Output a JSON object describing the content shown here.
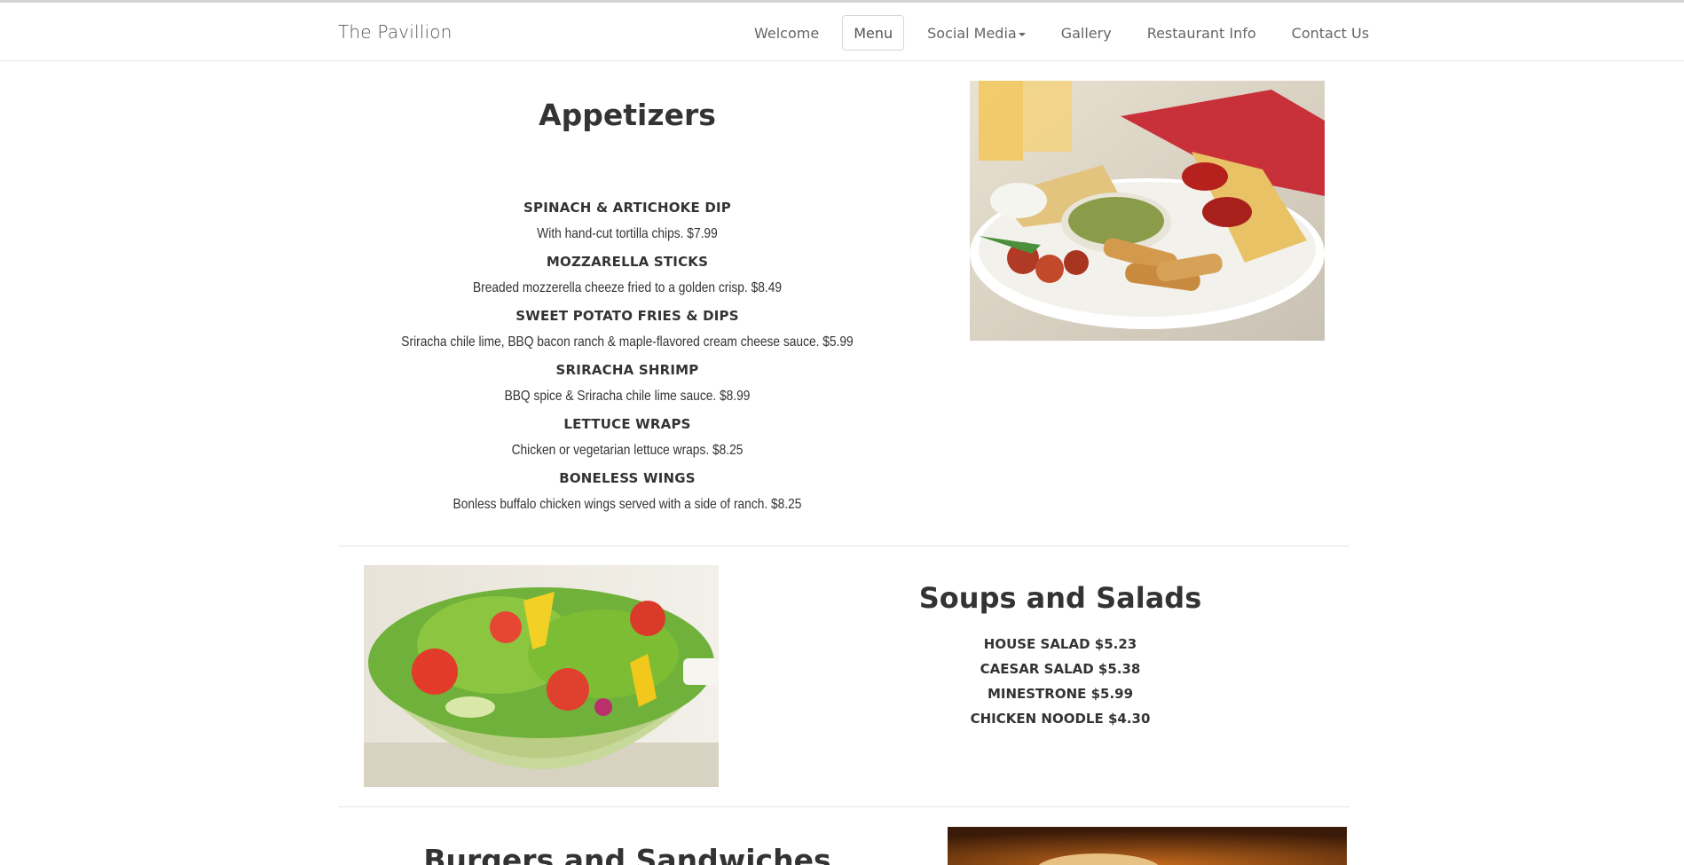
{
  "navbar": {
    "brand": "The Pavillion",
    "items": [
      {
        "label": "Welcome"
      },
      {
        "label": "Menu"
      },
      {
        "label": "Social Media"
      },
      {
        "label": "Gallery"
      },
      {
        "label": "Restaurant Info"
      },
      {
        "label": "Contact Us"
      }
    ]
  },
  "appetizers": {
    "title": "Appetizers",
    "items": [
      {
        "name": "SPINACH & ARTICHOKE DIP",
        "desc": "With hand-cut tortilla chips. $7.99"
      },
      {
        "name": "MOZZARELLA STICKS",
        "desc": "Breaded mozzerella cheeze fried to a golden crisp. $8.49"
      },
      {
        "name": "SWEET POTATO FRIES & DIPS",
        "desc": "Sriracha chile lime, BBQ bacon ranch & maple-flavored cream cheese sauce. $5.99"
      },
      {
        "name": "SRIRACHA SHRIMP",
        "desc": "BBQ spice & Sriracha chile lime sauce. $8.99"
      },
      {
        "name": "LETTUCE WRAPS",
        "desc": "Chicken or vegetarian lettuce wraps. $8.25"
      },
      {
        "name": "BONELESS WINGS",
        "desc": "Bonless buffalo chicken wings served with a side of ranch. $8.25"
      }
    ]
  },
  "soups": {
    "title": "Soups and Salads",
    "items": [
      {
        "label": "HOUSE SALAD $5.23"
      },
      {
        "label": "CAESAR SALAD $5.38"
      },
      {
        "label": "MINESTRONE $5.99"
      },
      {
        "label": "CHICKEN NOODLE $4.30"
      }
    ]
  },
  "burgers": {
    "title": "Burgers and Sandwiches"
  },
  "colors": {
    "text": "#333333",
    "nav_text": "#666666",
    "border": "#e7e7e7"
  }
}
